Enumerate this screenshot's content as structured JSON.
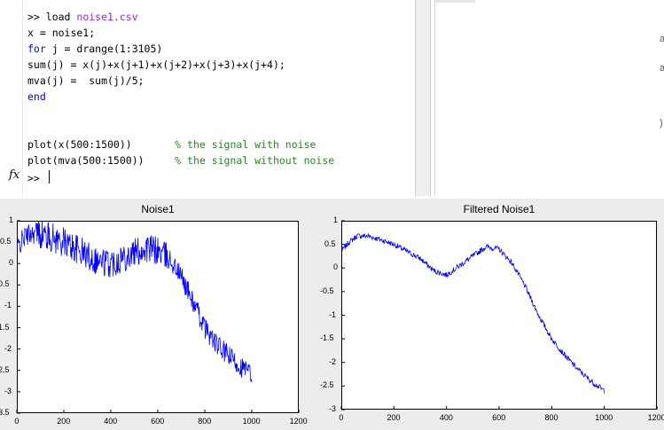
{
  "command_window": {
    "code_lines": [
      [
        {
          "t": ">> load ",
          "c": ""
        },
        {
          "t": "noise1.csv",
          "c": "str"
        }
      ],
      [
        {
          "t": "x = noise1;",
          "c": ""
        }
      ],
      [
        {
          "t": "for",
          "c": "kw"
        },
        {
          "t": " j = drange(1:3105)",
          "c": ""
        }
      ],
      [
        {
          "t": "sum(j) = x(j)+x(j+1)+x(j+2)+x(j+3)+x(j+4);",
          "c": ""
        }
      ],
      [
        {
          "t": "mva(j) =  sum(j)/5;",
          "c": ""
        }
      ],
      [
        {
          "t": "end",
          "c": "kw"
        }
      ],
      [
        {
          "t": "",
          "c": ""
        }
      ],
      [
        {
          "t": "",
          "c": ""
        }
      ],
      [
        {
          "t": "plot(x(500:1500))       ",
          "c": ""
        },
        {
          "t": "% the signal with noise",
          "c": "cmt"
        }
      ],
      [
        {
          "t": "plot(mva(500:1500))     ",
          "c": ""
        },
        {
          "t": "% the signal without noise",
          "c": "cmt"
        }
      ]
    ],
    "fx_label": "fx",
    "prompt": ">>",
    "right_pane_fragments": [
      "a",
      "a",
      ")"
    ]
  },
  "chart_data": [
    {
      "type": "line",
      "title": "Noise1",
      "xlabel": "",
      "ylabel": "",
      "xlim": [
        0,
        1200
      ],
      "ylim": [
        -3.5,
        1
      ],
      "xticks": [
        0,
        200,
        400,
        600,
        800,
        1000,
        1200
      ],
      "yticks": [
        1,
        0.5,
        0,
        -0.5,
        -1,
        -1.5,
        -2,
        -2.5,
        -3,
        -3.5
      ],
      "color": "#0000ff",
      "noise_amplitude": 0.25,
      "series": [
        {
          "x": [
            0,
            30,
            60,
            100,
            150,
            200,
            250,
            300,
            350,
            400,
            450,
            500,
            550,
            600,
            650,
            700,
            750,
            800,
            850,
            900,
            950,
            1000
          ],
          "y": [
            0.35,
            0.6,
            0.72,
            0.7,
            0.6,
            0.5,
            0.35,
            0.2,
            0.05,
            0.0,
            0.15,
            0.25,
            0.35,
            0.3,
            0.1,
            -0.3,
            -0.9,
            -1.5,
            -1.9,
            -2.15,
            -2.4,
            -2.6
          ]
        }
      ]
    },
    {
      "type": "line",
      "title": "Filtered Noise1",
      "xlabel": "",
      "ylabel": "",
      "xlim": [
        0,
        1200
      ],
      "ylim": [
        -3,
        1
      ],
      "xticks": [
        0,
        200,
        400,
        600,
        800,
        1000,
        1200
      ],
      "yticks": [
        1,
        0.5,
        0,
        -0.5,
        -1,
        -1.5,
        -2,
        -2.5,
        -3
      ],
      "color": "#0000ff",
      "noise_amplitude": 0.06,
      "series": [
        {
          "x": [
            0,
            30,
            60,
            100,
            150,
            200,
            250,
            300,
            350,
            400,
            450,
            500,
            550,
            600,
            650,
            700,
            750,
            800,
            850,
            900,
            950,
            1000
          ],
          "y": [
            0.35,
            0.55,
            0.68,
            0.68,
            0.6,
            0.5,
            0.35,
            0.2,
            -0.05,
            -0.15,
            0.05,
            0.25,
            0.45,
            0.4,
            0.1,
            -0.4,
            -1.0,
            -1.5,
            -1.85,
            -2.15,
            -2.4,
            -2.6
          ]
        }
      ]
    }
  ]
}
